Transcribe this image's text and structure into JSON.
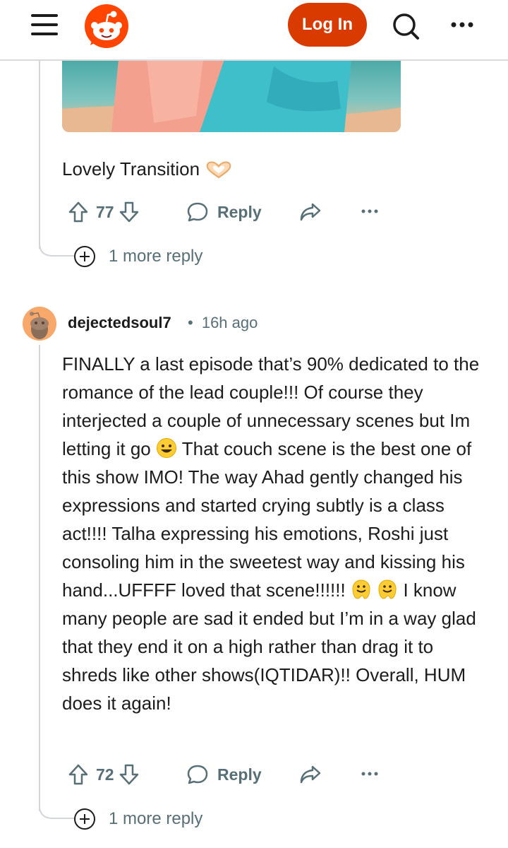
{
  "header": {
    "login_label": "Log In",
    "brand_color": "#d93a00",
    "icons": [
      "menu-icon",
      "reddit-logo",
      "search-icon",
      "overflow-menu-icon"
    ]
  },
  "comment1": {
    "text": "Lovely Transition",
    "emoji": "heart-hands-icon",
    "score": "77",
    "reply_label": "Reply",
    "more_replies": "1 more reply"
  },
  "comment2": {
    "author": "dejectedsoul7",
    "age": "16h ago",
    "separator": "•",
    "text_part1": "FINALLY a last episode that’s 90% dedicated to the romance of the lead couple!!! Of course they interjected a couple of unnecessary scenes but Im letting it go",
    "text_part2": "That couch scene is the best one of this show IMO! The way Ahad gently changed his expressions and started crying subtly is a class act!!!! Talha expressing his emotions, Roshi just consoling him in the sweetest way and kissing his hand...UFFFF loved that scene!!!!!!",
    "text_part3": "I know many people are sad it ended but I’m in a way glad that they end it on a high rather than drag it to shreds like other shows(IQTIDAR)!! Overall, HUM does it again!",
    "score": "72",
    "reply_label": "Reply",
    "more_replies": "1 more reply"
  }
}
